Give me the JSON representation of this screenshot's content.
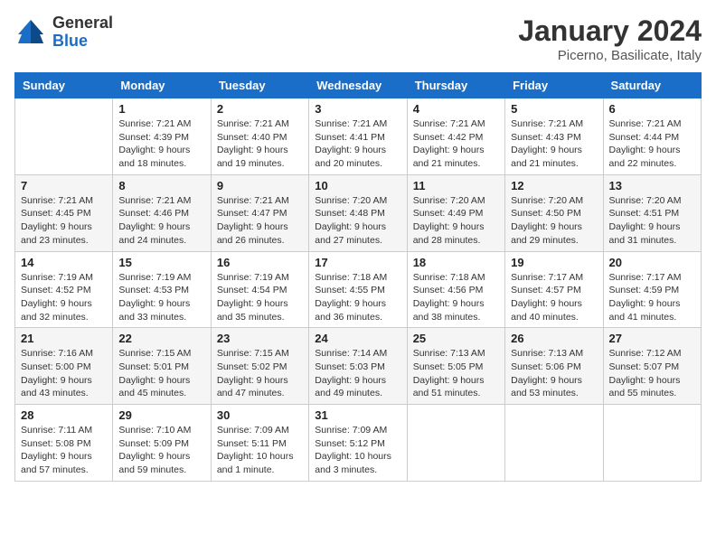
{
  "header": {
    "logo": {
      "general": "General",
      "blue": "Blue"
    },
    "title": "January 2024",
    "location": "Picerno, Basilicate, Italy"
  },
  "weekdays": [
    "Sunday",
    "Monday",
    "Tuesday",
    "Wednesday",
    "Thursday",
    "Friday",
    "Saturday"
  ],
  "weeks": [
    [
      {
        "day": "",
        "info": ""
      },
      {
        "day": "1",
        "info": "Sunrise: 7:21 AM\nSunset: 4:39 PM\nDaylight: 9 hours\nand 18 minutes."
      },
      {
        "day": "2",
        "info": "Sunrise: 7:21 AM\nSunset: 4:40 PM\nDaylight: 9 hours\nand 19 minutes."
      },
      {
        "day": "3",
        "info": "Sunrise: 7:21 AM\nSunset: 4:41 PM\nDaylight: 9 hours\nand 20 minutes."
      },
      {
        "day": "4",
        "info": "Sunrise: 7:21 AM\nSunset: 4:42 PM\nDaylight: 9 hours\nand 21 minutes."
      },
      {
        "day": "5",
        "info": "Sunrise: 7:21 AM\nSunset: 4:43 PM\nDaylight: 9 hours\nand 21 minutes."
      },
      {
        "day": "6",
        "info": "Sunrise: 7:21 AM\nSunset: 4:44 PM\nDaylight: 9 hours\nand 22 minutes."
      }
    ],
    [
      {
        "day": "7",
        "info": "Sunrise: 7:21 AM\nSunset: 4:45 PM\nDaylight: 9 hours\nand 23 minutes."
      },
      {
        "day": "8",
        "info": "Sunrise: 7:21 AM\nSunset: 4:46 PM\nDaylight: 9 hours\nand 24 minutes."
      },
      {
        "day": "9",
        "info": "Sunrise: 7:21 AM\nSunset: 4:47 PM\nDaylight: 9 hours\nand 26 minutes."
      },
      {
        "day": "10",
        "info": "Sunrise: 7:20 AM\nSunset: 4:48 PM\nDaylight: 9 hours\nand 27 minutes."
      },
      {
        "day": "11",
        "info": "Sunrise: 7:20 AM\nSunset: 4:49 PM\nDaylight: 9 hours\nand 28 minutes."
      },
      {
        "day": "12",
        "info": "Sunrise: 7:20 AM\nSunset: 4:50 PM\nDaylight: 9 hours\nand 29 minutes."
      },
      {
        "day": "13",
        "info": "Sunrise: 7:20 AM\nSunset: 4:51 PM\nDaylight: 9 hours\nand 31 minutes."
      }
    ],
    [
      {
        "day": "14",
        "info": "Sunrise: 7:19 AM\nSunset: 4:52 PM\nDaylight: 9 hours\nand 32 minutes."
      },
      {
        "day": "15",
        "info": "Sunrise: 7:19 AM\nSunset: 4:53 PM\nDaylight: 9 hours\nand 33 minutes."
      },
      {
        "day": "16",
        "info": "Sunrise: 7:19 AM\nSunset: 4:54 PM\nDaylight: 9 hours\nand 35 minutes."
      },
      {
        "day": "17",
        "info": "Sunrise: 7:18 AM\nSunset: 4:55 PM\nDaylight: 9 hours\nand 36 minutes."
      },
      {
        "day": "18",
        "info": "Sunrise: 7:18 AM\nSunset: 4:56 PM\nDaylight: 9 hours\nand 38 minutes."
      },
      {
        "day": "19",
        "info": "Sunrise: 7:17 AM\nSunset: 4:57 PM\nDaylight: 9 hours\nand 40 minutes."
      },
      {
        "day": "20",
        "info": "Sunrise: 7:17 AM\nSunset: 4:59 PM\nDaylight: 9 hours\nand 41 minutes."
      }
    ],
    [
      {
        "day": "21",
        "info": "Sunrise: 7:16 AM\nSunset: 5:00 PM\nDaylight: 9 hours\nand 43 minutes."
      },
      {
        "day": "22",
        "info": "Sunrise: 7:15 AM\nSunset: 5:01 PM\nDaylight: 9 hours\nand 45 minutes."
      },
      {
        "day": "23",
        "info": "Sunrise: 7:15 AM\nSunset: 5:02 PM\nDaylight: 9 hours\nand 47 minutes."
      },
      {
        "day": "24",
        "info": "Sunrise: 7:14 AM\nSunset: 5:03 PM\nDaylight: 9 hours\nand 49 minutes."
      },
      {
        "day": "25",
        "info": "Sunrise: 7:13 AM\nSunset: 5:05 PM\nDaylight: 9 hours\nand 51 minutes."
      },
      {
        "day": "26",
        "info": "Sunrise: 7:13 AM\nSunset: 5:06 PM\nDaylight: 9 hours\nand 53 minutes."
      },
      {
        "day": "27",
        "info": "Sunrise: 7:12 AM\nSunset: 5:07 PM\nDaylight: 9 hours\nand 55 minutes."
      }
    ],
    [
      {
        "day": "28",
        "info": "Sunrise: 7:11 AM\nSunset: 5:08 PM\nDaylight: 9 hours\nand 57 minutes."
      },
      {
        "day": "29",
        "info": "Sunrise: 7:10 AM\nSunset: 5:09 PM\nDaylight: 9 hours\nand 59 minutes."
      },
      {
        "day": "30",
        "info": "Sunrise: 7:09 AM\nSunset: 5:11 PM\nDaylight: 10 hours\nand 1 minute."
      },
      {
        "day": "31",
        "info": "Sunrise: 7:09 AM\nSunset: 5:12 PM\nDaylight: 10 hours\nand 3 minutes."
      },
      {
        "day": "",
        "info": ""
      },
      {
        "day": "",
        "info": ""
      },
      {
        "day": "",
        "info": ""
      }
    ]
  ]
}
